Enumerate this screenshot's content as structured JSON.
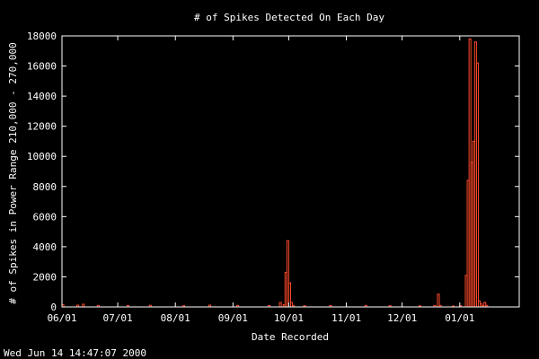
{
  "chart_data": {
    "type": "bar",
    "title": "# of Spikes Detected On Each Day",
    "xlabel": "Date Recorded",
    "ylabel": "# of Spikes in Power Range 210,000 - 270,000",
    "timestamp": "Wed Jun 14 14:47:07 2000",
    "colors": {
      "background": "#000000",
      "axes": "#ffffff",
      "bars": "#ff4a2a"
    },
    "ylim": [
      0,
      18000
    ],
    "yticks": [
      0,
      2000,
      4000,
      6000,
      8000,
      10000,
      12000,
      14000,
      16000,
      18000
    ],
    "ytick_labels": [
      "0",
      "2000",
      "4000",
      "6000",
      "8000",
      "10000",
      "12000",
      "14000",
      "16000",
      "18000"
    ],
    "xlim": [
      "2000-06-01",
      "2001-02-02"
    ],
    "xticks": [
      "2000-06-01",
      "2000-07-01",
      "2000-08-01",
      "2000-09-01",
      "2000-10-01",
      "2000-11-01",
      "2000-12-01",
      "2001-01-01"
    ],
    "xtick_labels": [
      "06/01",
      "07/01",
      "08/01",
      "09/01",
      "10/01",
      "11/01",
      "12/01",
      "01/01"
    ],
    "series": [
      {
        "x": [
          "2000-06-01",
          "2000-06-09",
          "2000-06-12",
          "2000-06-20",
          "2000-07-06",
          "2000-07-18",
          "2000-08-05",
          "2000-08-19",
          "2000-09-03",
          "2000-09-20",
          "2000-09-26",
          "2000-09-28",
          "2000-09-29",
          "2000-09-30",
          "2000-10-01",
          "2000-10-02",
          "2000-10-03",
          "2000-10-09",
          "2000-10-23",
          "2000-11-11",
          "2000-11-24",
          "2000-12-10",
          "2000-12-18",
          "2000-12-20",
          "2000-12-21",
          "2000-12-28",
          "2001-01-01",
          "2001-01-04",
          "2001-01-05",
          "2001-01-06",
          "2001-01-07",
          "2001-01-08",
          "2001-01-09",
          "2001-01-10",
          "2001-01-11",
          "2001-01-12",
          "2001-01-13",
          "2001-01-14",
          "2001-01-15"
        ],
        "values": [
          150,
          120,
          180,
          100,
          90,
          110,
          80,
          120,
          100,
          90,
          300,
          150,
          2300,
          4400,
          1600,
          300,
          100,
          80,
          90,
          100,
          80,
          70,
          100,
          850,
          100,
          60,
          80,
          2100,
          8400,
          17800,
          9600,
          11000,
          17600,
          16200,
          400,
          200,
          80,
          300,
          100
        ]
      }
    ]
  }
}
